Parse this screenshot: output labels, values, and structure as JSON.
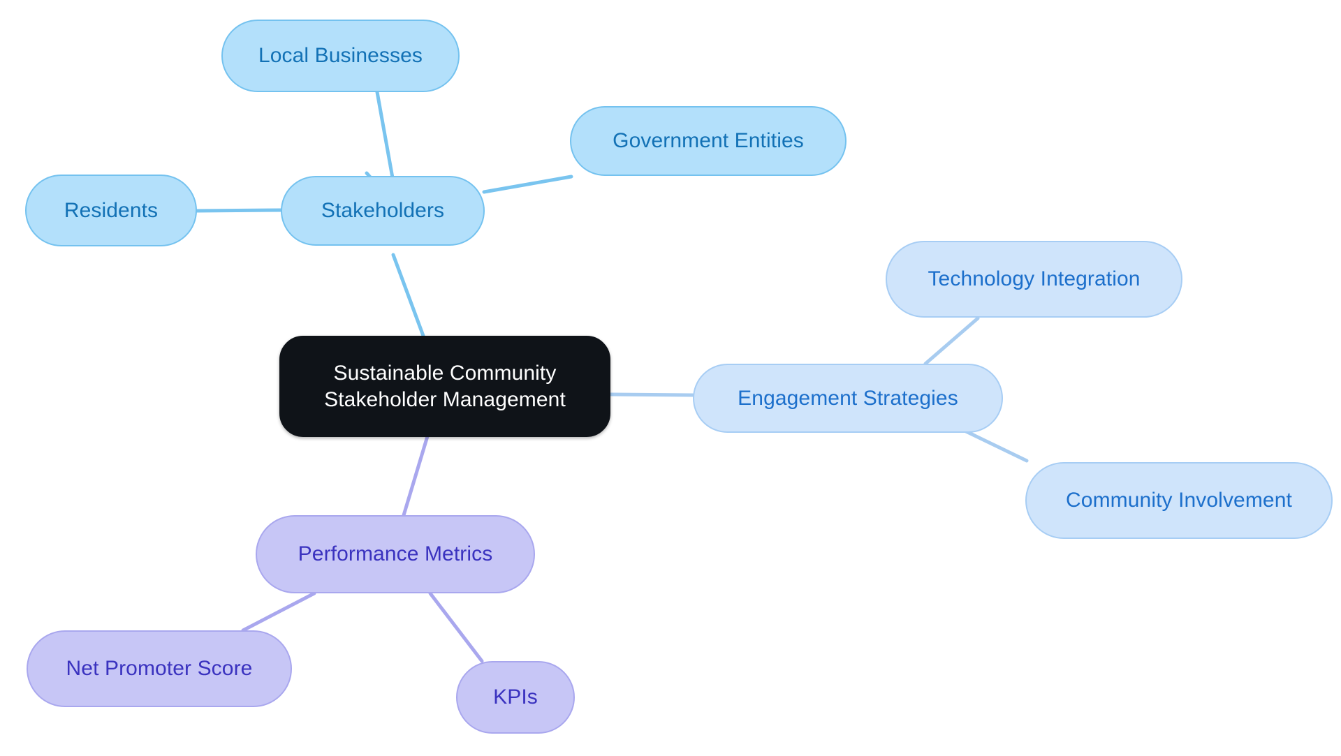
{
  "diagram": {
    "type": "mind-map",
    "background": "#ffffff",
    "root": {
      "id": "root",
      "label": "Sustainable Community\nStakeholder Management",
      "fill": "#0f1318",
      "text_color": "#ffffff"
    },
    "branches": [
      {
        "id": "stakeholders",
        "label": "Stakeholders",
        "fill": "#b3e0fb",
        "stroke": "#74c2ef",
        "text_color": "#1271b5",
        "children": [
          {
            "id": "local-businesses",
            "label": "Local Businesses"
          },
          {
            "id": "government-entities",
            "label": "Government Entities"
          },
          {
            "id": "residents",
            "label": "Residents"
          }
        ]
      },
      {
        "id": "engagement-strategies",
        "label": "Engagement Strategies",
        "fill": "#cfe4fb",
        "stroke": "#a7cdf4",
        "text_color": "#1c6fcb",
        "children": [
          {
            "id": "technology-integration",
            "label": "Technology Integration"
          },
          {
            "id": "community-involvement",
            "label": "Community Involvement"
          }
        ]
      },
      {
        "id": "performance-metrics",
        "label": "Performance Metrics",
        "fill": "#c7c6f6",
        "stroke": "#a9a7ee",
        "text_color": "#3a32bf",
        "children": [
          {
            "id": "net-promoter-score",
            "label": "Net Promoter Score"
          },
          {
            "id": "kpis",
            "label": "KPIs"
          }
        ]
      }
    ],
    "edge_colors": {
      "stakeholders": "#79c4ef",
      "engagement": "#a8ccf0",
      "performance": "#a9a7ee"
    }
  }
}
